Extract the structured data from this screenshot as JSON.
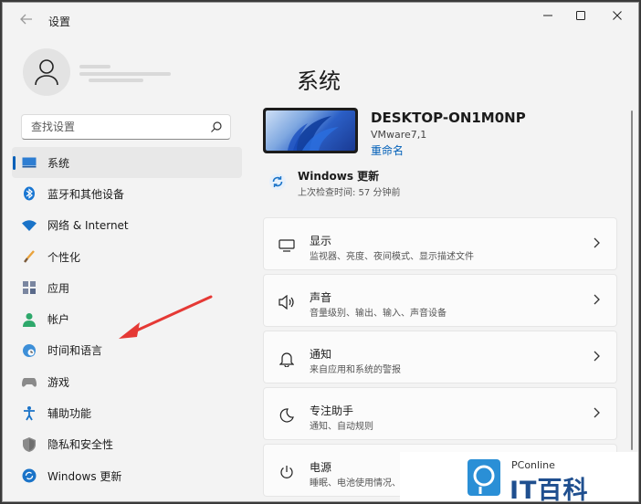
{
  "window": {
    "title": "设置",
    "back_icon": "back-arrow-icon",
    "controls": {
      "minimize": "—",
      "maximize": "□",
      "close": "✕"
    }
  },
  "search": {
    "placeholder": "查找设置"
  },
  "sidebar": {
    "items": [
      {
        "label": "系统",
        "icon": "monitor-icon",
        "active": true
      },
      {
        "label": "蓝牙和其他设备",
        "icon": "bluetooth-icon"
      },
      {
        "label": "网络 & Internet",
        "icon": "wifi-icon"
      },
      {
        "label": "个性化",
        "icon": "paintbrush-icon"
      },
      {
        "label": "应用",
        "icon": "apps-icon"
      },
      {
        "label": "帐户",
        "icon": "person-icon"
      },
      {
        "label": "时间和语言",
        "icon": "globe-clock-icon"
      },
      {
        "label": "游戏",
        "icon": "gamepad-icon"
      },
      {
        "label": "辅助功能",
        "icon": "accessibility-icon"
      },
      {
        "label": "隐私和安全性",
        "icon": "shield-icon"
      },
      {
        "label": "Windows 更新",
        "icon": "update-icon"
      }
    ]
  },
  "main": {
    "title": "系统",
    "device": {
      "name": "DESKTOP-ON1M0NP",
      "model": "VMware7,1",
      "rename": "重命名"
    },
    "windows_update": {
      "title": "Windows 更新",
      "subtitle": "上次检查时间: 57 分钟前"
    },
    "cards": [
      {
        "title": "显示",
        "subtitle": "监视器、亮度、夜间模式、显示描述文件",
        "icon": "display-icon"
      },
      {
        "title": "声音",
        "subtitle": "音量级别、输出、输入、声音设备",
        "icon": "speaker-icon"
      },
      {
        "title": "通知",
        "subtitle": "来自应用和系统的警报",
        "icon": "bell-icon"
      },
      {
        "title": "专注助手",
        "subtitle": "通知、自动规则",
        "icon": "moon-icon"
      },
      {
        "title": "电源",
        "subtitle": "睡眠、电池使用情况、",
        "icon": "power-icon"
      }
    ]
  },
  "watermark": {
    "sub": "PConline",
    "main": "IT百科"
  },
  "colors": {
    "accent": "#005fb8",
    "annotation_arrow": "#e53935"
  }
}
